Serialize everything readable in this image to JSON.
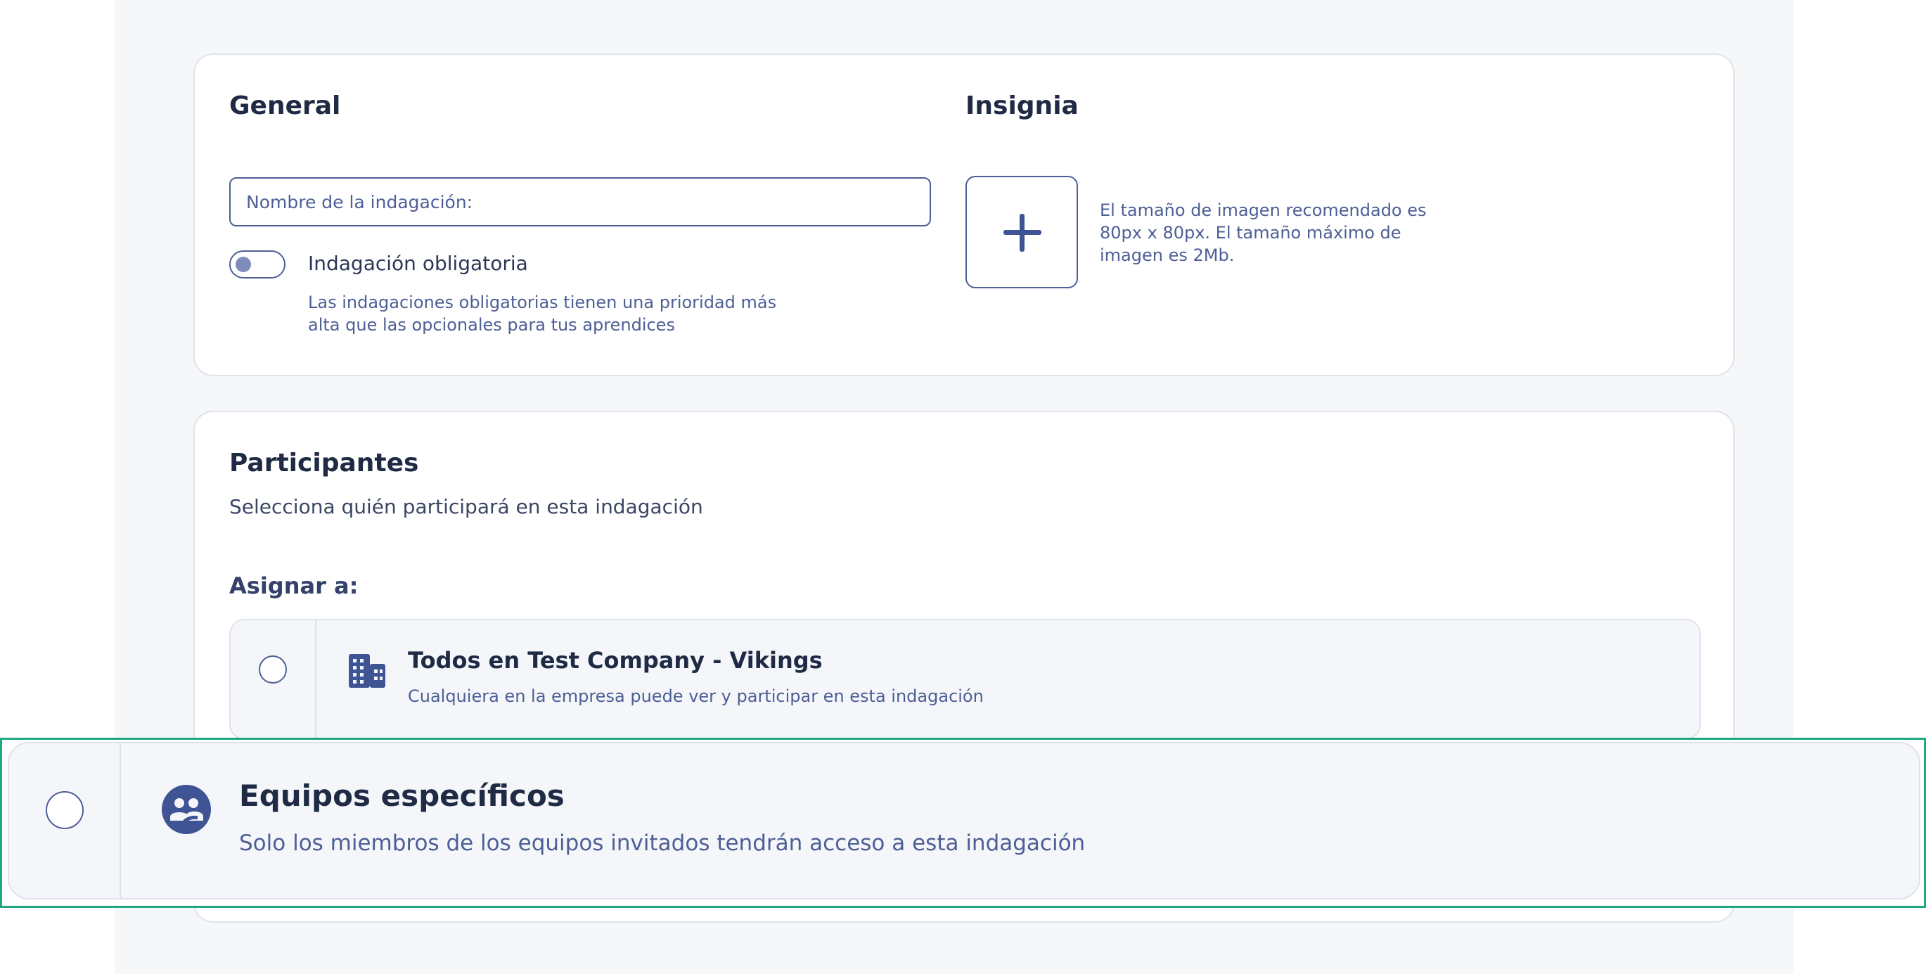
{
  "general": {
    "title": "General",
    "name_placeholder": "Nombre de la indagación:",
    "mandatory_label": "Indagación obligatoria",
    "mandatory_help_line1": "Las indagaciones obligatorias tienen una prioridad más",
    "mandatory_help_line2": "alta que las opcionales para tus aprendices"
  },
  "badge": {
    "title": "Insignia",
    "help_line1": "El tamaño de imagen recomendado es",
    "help_line2": "80px x 80px. El tamaño máximo de",
    "help_line3": "imagen es 2Mb."
  },
  "participants": {
    "title": "Participantes",
    "subtitle": "Selecciona quién participará en esta indagación",
    "assign_label": "Asignar a:",
    "options": [
      {
        "title": "Todos en Test Company - Vikings",
        "description": "Cualquiera en la empresa puede ver y participar en esta indagación",
        "icon": "building-icon"
      },
      {
        "title": "Equipos específicos",
        "description": "Solo los miembros de los equipos invitados tendrán acceso a esta indagación",
        "icon": "team-icon"
      }
    ]
  },
  "colors": {
    "accent": "#4d5f95",
    "focus": "#1fa882",
    "background": "#f6f7f9"
  }
}
